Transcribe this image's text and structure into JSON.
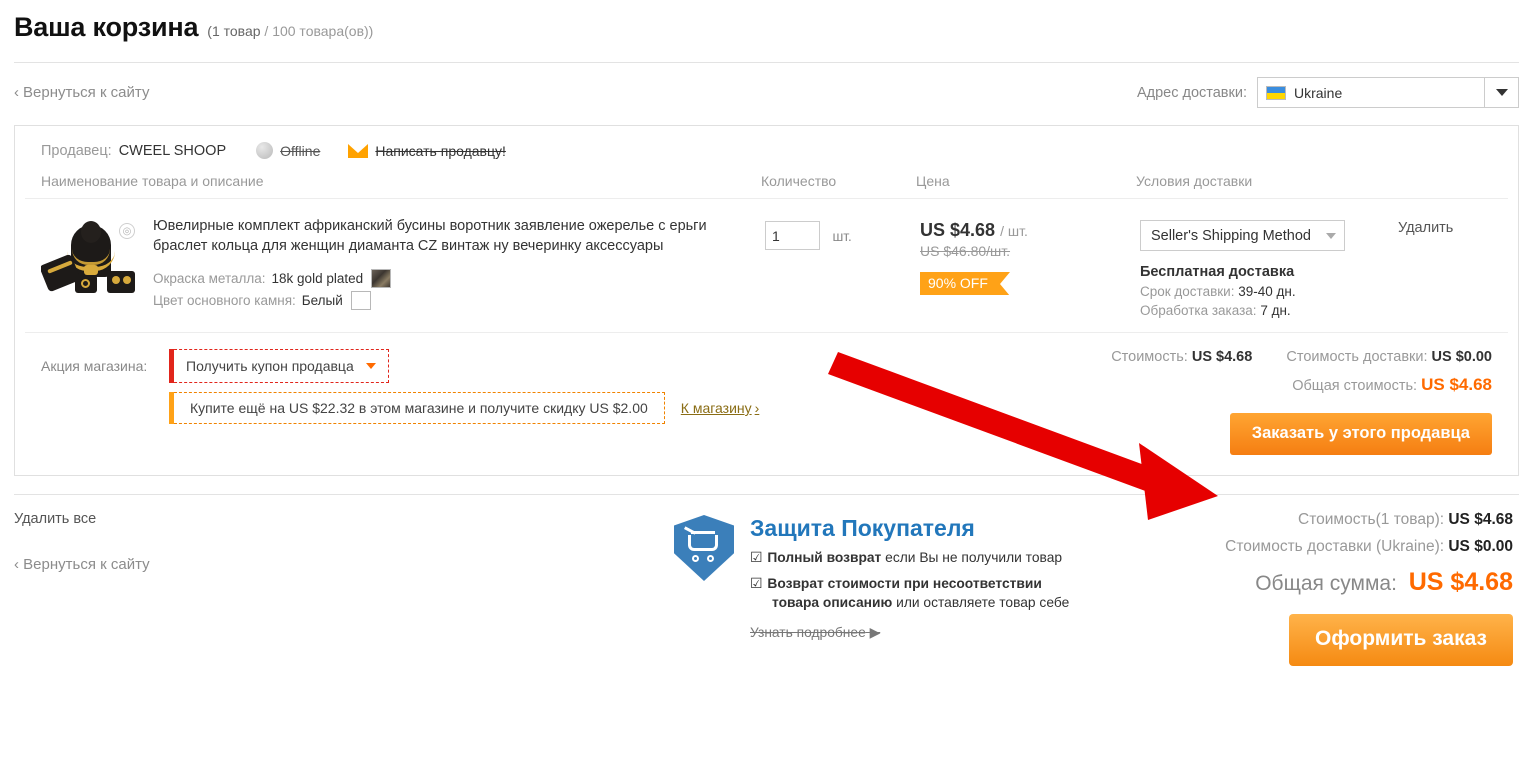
{
  "header": {
    "title": "Ваша корзина",
    "count_items": "(1 товар",
    "count_sep": "/",
    "count_total": "100 товара(ов))",
    "back_link": "Вернуться к сайту",
    "back_chevron": "‹",
    "address_label": "Адрес доставки:",
    "address_value": "Ukraine",
    "flag_icon": "ukraine-flag-icon"
  },
  "seller": {
    "label": "Продавец:",
    "name": "CWEEL SHOOP",
    "status": "Offline",
    "status_icon": "offline-dot-icon",
    "message_link": "Написать продавцу!",
    "message_icon": "envelope-icon"
  },
  "columns": {
    "name": "Наименование товара и описание",
    "quantity": "Количество",
    "price": "Цена",
    "shipping": "Условия доставки"
  },
  "product": {
    "thumb_icon": "jewelry-set-thumbnail",
    "title": "Ювелирные комплект африканский бусины воротник заявление ожерелье с ерьги браслет кольца для женщин диаманта CZ винтаж ну вечеринку аксессуары",
    "attributes": [
      {
        "key": "Окраска металла:",
        "value": "18k gold plated",
        "swatch": "gold-plated-swatch"
      },
      {
        "key": "Цвет основного камня:",
        "value": "Белый",
        "swatch": "white-swatch"
      }
    ],
    "qty_value": "1",
    "qty_unit": "шт.",
    "price_now": "US $4.68",
    "price_per": "/ шт.",
    "price_old": "US $46.80/шт.",
    "discount_badge": "90% OFF",
    "shipping_method": "Seller's Shipping Method",
    "shipping_free": "Бесплатная доставка",
    "delivery_label": "Срок доставки:",
    "delivery_value": "39-40 дн.",
    "processing_label": "Обработка заказа:",
    "processing_value": "7 дн.",
    "delete_link": "Удалить"
  },
  "promo": {
    "label": "Акция магазина:",
    "coupon_text": "Получить купон продавца",
    "offer_text": "Купите ещё на US $22.32 в этом магазине и получите скидку US $2.00",
    "shop_link": "К магазину",
    "shop_arrow": "›"
  },
  "seller_totals": {
    "subtotal_label": "Стоимость:",
    "subtotal_value": "US $4.68",
    "shipping_label": "Стоимость доставки:",
    "shipping_value": "US $0.00",
    "total_label": "Общая стоимость:",
    "total_value": "US $4.68",
    "order_button": "Заказать у этого продавца"
  },
  "footer": {
    "remove_all": "Удалить все",
    "back_link": "Вернуться к сайту",
    "back_chevron": "‹"
  },
  "protection": {
    "shield_icon": "buyer-protection-shield-icon",
    "title": "Защита Покупателя",
    "check_icon": "checkbox-checked-icon",
    "item1_bold": "Полный возврат",
    "item1_rest": "если Вы не получили товар",
    "item2_bold": "Возврат стоимости при несоответствии",
    "item2_bold2": "товара описанию",
    "item2_rest": "или оставляете товар себе",
    "more_link": "Узнать подробнее",
    "more_arrow": "▶"
  },
  "summary": {
    "subtotal_label": "Стоимость(1 товар):",
    "subtotal_value": "US $4.68",
    "shipping_label": "Стоимость доставки (Ukraine):",
    "shipping_value": "US $0.00",
    "total_label": "Общая сумма:",
    "total_value": "US $4.68",
    "checkout_button": "Оформить заказ"
  },
  "annotation": {
    "arrow_icon": "red-arrow-pointing-to-order-button",
    "color": "#e60000"
  },
  "colors": {
    "accent_orange": "#ff6a00",
    "button_orange": "#f58a12",
    "protect_blue": "#2277bb",
    "coupon_red": "#e1251b"
  }
}
